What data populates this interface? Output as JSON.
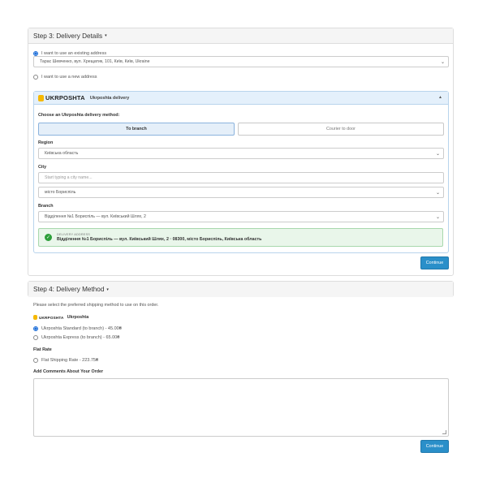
{
  "step3": {
    "title": "Step 3: Delivery Details",
    "caret": "▾",
    "existing_label": "I want to use an existing address",
    "existing_value": "Тарас Шевченко, вул. Хрещатик, 101, Київ, Київ, Ukraine",
    "new_label": "I want to use a new address",
    "ukr": {
      "logo": "UKRPOSHTA",
      "title": "Ukrposhta delivery",
      "method_label": "Choose an Ukrposhta delivery method:",
      "to_branch": "To branch",
      "courier": "Courier to door",
      "region_label": "Region",
      "region_value": "Київська область",
      "city_label": "City",
      "city_placeholder": "Start typing a city name...",
      "city_value": "місто Бориспіль",
      "branch_label": "Branch",
      "branch_value": "Відділення №1 Бориспіль — вул. Київський Шлях, 2",
      "delivery_address_label": "DELIVERY ADDRESS",
      "delivery_address": "Відділення №1 Бориспіль — вул. Київський Шлях, 2 · 08300, місто Бориспіль, Київська область"
    },
    "continue": "Continue"
  },
  "step4": {
    "title": "Step 4: Delivery Method",
    "caret": "▾",
    "intro": "Please select the preferred shipping method to use on this order.",
    "ukr_logo": "UKRPOSHTA",
    "ukr_group": "Ukrposhta",
    "option1": "Ukrposhta Standard (to branch) - 45.00₴",
    "option2": "Ukrposhta Express (to branch) - 65.00₴",
    "flat_label": "Flat Rate",
    "flat_option": "Flat Shipping Rate - 223.75₴",
    "comments_label": "Add Comments About Your Order",
    "continue": "Continue"
  },
  "colors": {
    "accent": "#2a8fc9",
    "success": "#2d9f3a",
    "brand": "#f6b800"
  },
  "icons": {
    "dropdown": "chevron-down-icon",
    "collapse": "chevron-up-icon",
    "success": "check-circle-icon"
  }
}
